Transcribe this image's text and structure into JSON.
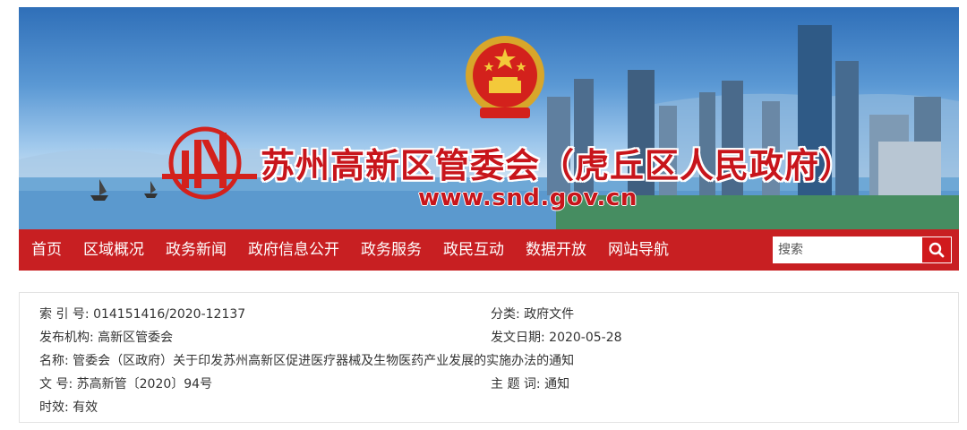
{
  "header": {
    "title": "苏州高新区管委会（虎丘区人民政府）",
    "url": "www.snd.gov.cn",
    "emblem_icon": "national-emblem-icon",
    "logo_icon": "snd-logo-icon"
  },
  "nav": {
    "items": [
      "首页",
      "区域概况",
      "政务新闻",
      "政府信息公开",
      "政务服务",
      "政民互动",
      "数据开放",
      "网站导航"
    ],
    "search_placeholder": "搜索",
    "search_icon": "search-icon"
  },
  "meta": {
    "index_label": "索 引 号:",
    "index_value": "014151416/2020-12137",
    "category_label": "分类:",
    "category_value": "政府文件",
    "publisher_label": "发布机构:",
    "publisher_value": "高新区管委会",
    "date_label": "发文日期:",
    "date_value": "2020-05-28",
    "name_label": "名称:",
    "name_value": "管委会（区政府）关于印发苏州高新区促进医疗器械及生物医药产业发展的实施办法的通知",
    "docno_label": "文 号:",
    "docno_value": "苏高新管〔2020〕94号",
    "keyword_label": "主 题 词:",
    "keyword_value": "通知",
    "validity_label": "时效:",
    "validity_value": "有效"
  },
  "colors": {
    "brand_red": "#c81f22",
    "title_red": "#c8151b",
    "sky_blue": "#5a98d4"
  }
}
